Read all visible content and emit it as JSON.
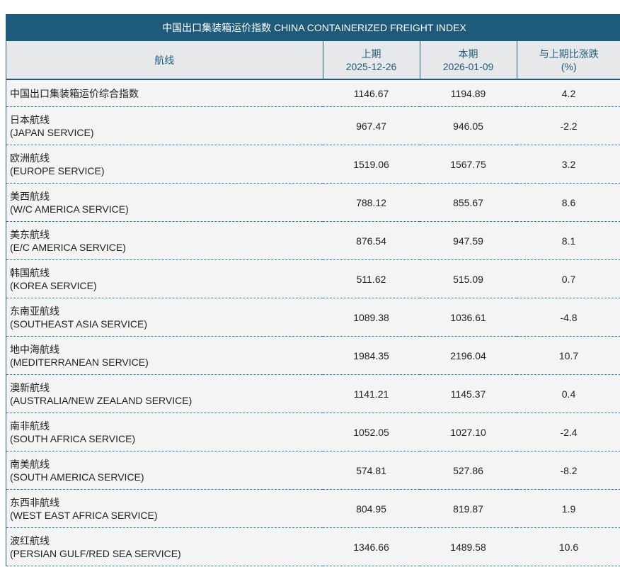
{
  "title": "中国出口集装箱运价指数 CHINA CONTAINERIZED FREIGHT INDEX",
  "headers": {
    "route": "航线",
    "prev_label": "上期",
    "prev_date": "2025-12-26",
    "curr_label": "本期",
    "curr_date": "2026-01-09",
    "change_label": "与上期比涨跌",
    "change_unit": "(%)"
  },
  "rows": [
    {
      "name_cn": "中国出口集装箱运价综合指数",
      "name_en": "",
      "prev": "1146.67",
      "curr": "1194.89",
      "change": "4.2"
    },
    {
      "name_cn": "日本航线",
      "name_en": "(JAPAN SERVICE)",
      "prev": "967.47",
      "curr": "946.05",
      "change": "-2.2"
    },
    {
      "name_cn": "欧洲航线",
      "name_en": "(EUROPE SERVICE)",
      "prev": "1519.06",
      "curr": "1567.75",
      "change": "3.2"
    },
    {
      "name_cn": "美西航线",
      "name_en": "(W/C AMERICA SERVICE)",
      "prev": "788.12",
      "curr": "855.67",
      "change": "8.6"
    },
    {
      "name_cn": "美东航线",
      "name_en": "(E/C AMERICA SERVICE)",
      "prev": "876.54",
      "curr": "947.59",
      "change": "8.1"
    },
    {
      "name_cn": "韩国航线",
      "name_en": "(KOREA SERVICE)",
      "prev": "511.62",
      "curr": "515.09",
      "change": "0.7"
    },
    {
      "name_cn": "东南亚航线",
      "name_en": "(SOUTHEAST ASIA SERVICE)",
      "prev": "1089.38",
      "curr": "1036.61",
      "change": "-4.8"
    },
    {
      "name_cn": "地中海航线",
      "name_en": "(MEDITERRANEAN SERVICE)",
      "prev": "1984.35",
      "curr": "2196.04",
      "change": "10.7"
    },
    {
      "name_cn": "澳新航线",
      "name_en": "(AUSTRALIA/NEW ZEALAND SERVICE)",
      "prev": "1141.21",
      "curr": "1145.37",
      "change": "0.4"
    },
    {
      "name_cn": "南非航线",
      "name_en": "(SOUTH AFRICA SERVICE)",
      "prev": "1052.05",
      "curr": "1027.10",
      "change": "-2.4"
    },
    {
      "name_cn": "南美航线",
      "name_en": "(SOUTH AMERICA SERVICE)",
      "prev": "574.81",
      "curr": "527.86",
      "change": "-8.2"
    },
    {
      "name_cn": "东西非航线",
      "name_en": "(WEST EAST AFRICA SERVICE)",
      "prev": "804.95",
      "curr": "819.87",
      "change": "1.9"
    },
    {
      "name_cn": "波红航线",
      "name_en": "(PERSIAN GULF/RED SEA SERVICE)",
      "prev": "1346.66",
      "curr": "1489.58",
      "change": "10.6"
    }
  ]
}
